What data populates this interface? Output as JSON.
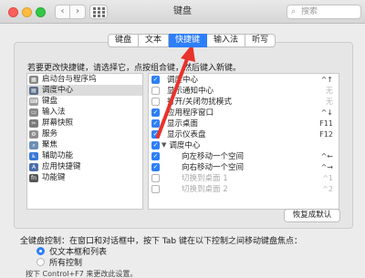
{
  "window": {
    "title": "键盘",
    "search_placeholder": "搜索"
  },
  "tabs": [
    {
      "label": "键盘",
      "active": false
    },
    {
      "label": "文本",
      "active": false
    },
    {
      "label": "快捷键",
      "active": true
    },
    {
      "label": "输入法",
      "active": false
    },
    {
      "label": "听写",
      "active": false
    }
  ],
  "hint": "若要更改快捷键，请选择它，点按组合键，然后键入新键。",
  "categories": [
    {
      "label": "启动台与程序坞",
      "icon": "launchpad-icon",
      "color": "#888888"
    },
    {
      "label": "调度中心",
      "icon": "mission-control-icon",
      "color": "#5a6f8a"
    },
    {
      "label": "键盘",
      "icon": "keyboard-icon",
      "color": "#9b9b9b"
    },
    {
      "label": "输入法",
      "icon": "input-method-icon",
      "color": "#8a8a8a"
    },
    {
      "label": "屏幕快照",
      "icon": "screenshot-icon",
      "color": "#7a7a7a"
    },
    {
      "label": "服务",
      "icon": "gear-icon",
      "color": "#8e8e8e"
    },
    {
      "label": "聚焦",
      "icon": "spotlight-icon",
      "color": "#6c8fb5"
    },
    {
      "label": "辅助功能",
      "icon": "accessibility-icon",
      "color": "#3a78d8"
    },
    {
      "label": "应用快捷键",
      "icon": "app-shortcuts-icon",
      "color": "#4a6ea8"
    },
    {
      "label": "功能键",
      "icon": "function-keys-icon",
      "color": "#555555"
    }
  ],
  "selected_category": "调度中心",
  "shortcuts": [
    {
      "name": "调度中心",
      "key": "^↑",
      "checked": true,
      "indent": false,
      "dim": false
    },
    {
      "name": "显示通知中心",
      "key": "无",
      "checked": false,
      "indent": false,
      "dim": false
    },
    {
      "name": "打开/关闭勿扰模式",
      "key": "无",
      "checked": false,
      "indent": false,
      "dim": false
    },
    {
      "name": "应用程序窗口",
      "key": "^↓",
      "checked": true,
      "indent": false,
      "dim": false
    },
    {
      "name": "显示桌面",
      "key": "F11",
      "checked": true,
      "indent": false,
      "dim": false
    },
    {
      "name": "显示仪表盘",
      "key": "F12",
      "checked": true,
      "indent": false,
      "dim": false
    },
    {
      "name": "调度中心",
      "key": "",
      "checked": true,
      "indent": false,
      "dim": false,
      "group": true
    },
    {
      "name": "向左移动一个空间",
      "key": "^←",
      "checked": true,
      "indent": true,
      "dim": false
    },
    {
      "name": "向右移动一个空间",
      "key": "^→",
      "checked": true,
      "indent": true,
      "dim": false
    },
    {
      "name": "切换到桌面 1",
      "key": "^1",
      "checked": false,
      "indent": true,
      "dim": true
    },
    {
      "name": "切换到桌面 2",
      "key": "^2",
      "checked": false,
      "indent": true,
      "dim": true
    }
  ],
  "reset_button": "恢复成默认",
  "keyboard_control_label": "全键盘控制：在窗口和对话框中，按下 Tab 键在以下控制之间移动键盘焦点：",
  "radio_options": [
    {
      "label": "仅文本框和列表",
      "selected": true
    },
    {
      "label": "所有控制",
      "selected": false
    }
  ],
  "footnote": "按下 Control+F7 来更改此设置。",
  "accent_color": "#2d7ff9",
  "annotation_arrow_color": "#e8322c"
}
